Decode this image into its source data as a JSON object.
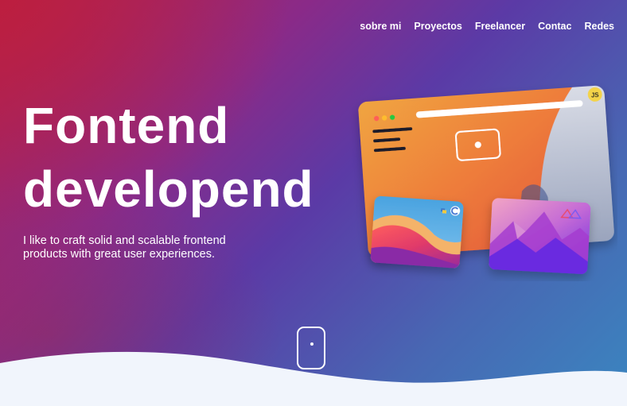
{
  "nav": {
    "items": [
      {
        "label": "sobre mi"
      },
      {
        "label": "Proyectos"
      },
      {
        "label": "Freelancer"
      },
      {
        "label": "Contac"
      },
      {
        "label": "Redes"
      }
    ]
  },
  "hero": {
    "title_line1": "Fontend",
    "title_line2": "developend",
    "subtitle_line1": "I like to craft solid and scalable frontend",
    "subtitle_line2": "products with great user experiences."
  },
  "illustration": {
    "js_badge": "JS"
  },
  "colors": {
    "text": "#ffffff",
    "wave": "#f1f5fc",
    "gradient_start": "#b3214f",
    "gradient_mid": "#5b3aa6",
    "gradient_end": "#3a86c0"
  }
}
